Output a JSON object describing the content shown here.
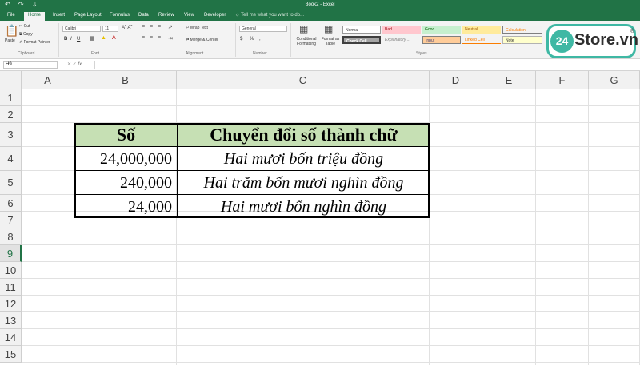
{
  "window": {
    "title": "Book2 - Excel",
    "qat": "↶ ↷ ⇩"
  },
  "tabs": [
    "File",
    "Home",
    "Insert",
    "Page Layout",
    "Formulas",
    "Data",
    "Review",
    "View",
    "Developer"
  ],
  "tell_me": "Tell me what you want to do...",
  "ribbon": {
    "clipboard": {
      "paste": "Paste",
      "cut": "Cut",
      "copy": "Copy",
      "format_painter": "Format Painter",
      "label": "Clipboard"
    },
    "font": {
      "name": "Calibri",
      "size": "11",
      "label": "Font",
      "bold": "B",
      "italic": "I",
      "underline": "U"
    },
    "alignment": {
      "wrap": "Wrap Text",
      "merge": "Merge & Center",
      "label": "Alignment"
    },
    "number": {
      "format": "General",
      "label": "Number",
      "currency": "$",
      "percent": "%",
      "comma": ","
    },
    "styles": {
      "conditional": "Conditional Formatting",
      "format_table": "Format as Table",
      "label": "Styles",
      "items": [
        "Normal",
        "Bad",
        "Good",
        "Neutral",
        "Calculation",
        "Check Cell",
        "Explanatory ...",
        "Input",
        "Linked Cell",
        "Note"
      ]
    }
  },
  "formula_bar": {
    "name_box": "H9",
    "fx": "fx",
    "value": ""
  },
  "columns": [
    "A",
    "B",
    "C",
    "D",
    "E",
    "F",
    "G"
  ],
  "rows": [
    "1",
    "2",
    "3",
    "4",
    "5",
    "6",
    "7",
    "8",
    "9",
    "10",
    "11",
    "12",
    "13",
    "14",
    "15"
  ],
  "table": {
    "header": [
      "Số",
      "Chuyển đổi số thành chữ"
    ],
    "rows": [
      [
        "24,000,000",
        "Hai mươi bốn triệu đồng"
      ],
      [
        "240,000",
        "Hai trăm bốn mươi nghìn đồng"
      ],
      [
        "24,000",
        "Hai mươi bốn nghìn đồng"
      ]
    ]
  },
  "logo": {
    "badge": "24",
    "text": "Store.vn",
    "reg": "®"
  },
  "colors": {
    "excel_green": "#217346",
    "header_fill": "#c6e0b4",
    "logo_teal": "#3fb8a4"
  }
}
